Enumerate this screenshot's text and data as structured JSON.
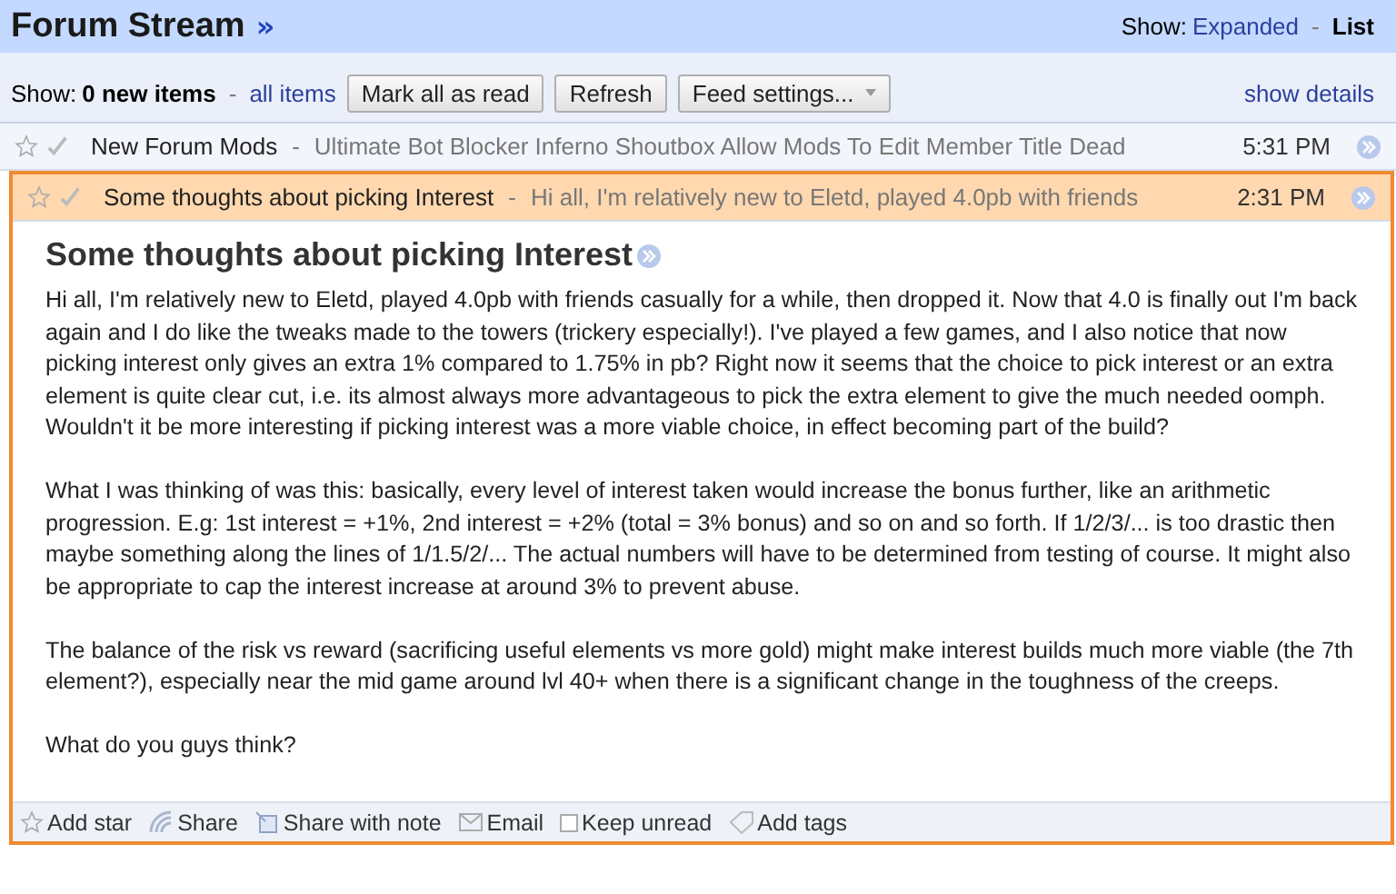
{
  "header": {
    "title": "Forum Stream",
    "title_link": "»",
    "show_label": "Show:",
    "separator": "-",
    "view_modes": [
      {
        "label": "Expanded",
        "selected": false
      },
      {
        "label": "List",
        "selected": true
      }
    ]
  },
  "toolbar": {
    "show_label": "Show:",
    "separator": "-",
    "filters": [
      {
        "label": "0 new items",
        "selected": true
      },
      {
        "label": "all items",
        "selected": false
      }
    ],
    "buttons": [
      {
        "label": "Mark all as read",
        "kind": "button"
      },
      {
        "label": "Refresh",
        "kind": "button"
      },
      {
        "label": "Feed settings...",
        "kind": "dropdown"
      }
    ],
    "details_link": "show details"
  },
  "items": [
    {
      "title": "New Forum Mods",
      "separator": "-",
      "snippet": "Ultimate Bot Blocker Inferno Shoutbox Allow Mods To Edit Member Title Dead",
      "time": "5:31 PM",
      "starred": false,
      "expanded": false
    },
    {
      "title": "Some thoughts about picking Interest",
      "separator": "-",
      "snippet": "Hi all, I'm relatively new to Eletd, played 4.0pb with friends",
      "time": "2:31 PM",
      "starred": false,
      "expanded": true,
      "body": {
        "title": "Some thoughts about picking Interest",
        "paragraphs": [
          "Hi all, I'm relatively new to Eletd, played 4.0pb with friends casually for a while, then dropped it. Now that 4.0 is finally out I'm back again and I do like the tweaks made to the towers (trickery especially!). I've played a few games, and I also notice that now picking interest only gives an extra 1% compared to 1.75% in pb? Right now it seems that the choice to pick interest or an extra element is quite clear cut, i.e. its almost always more advantageous to pick the extra element to give the much needed oomph. Wouldn't it be more interesting if picking interest was a more viable choice, in effect becoming part of the build?",
          "What I was thinking of was this: basically, every level of interest taken would increase the bonus further, like an arithmetic progression. E.g: 1st interest = +1%, 2nd interest = +2% (total = 3% bonus) and so on and so forth. If 1/2/3/... is too drastic then maybe something along the lines of 1/1.5/2/... The actual numbers will have to be determined from testing of course. It might also be appropriate to cap the interest increase at around 3% to prevent abuse.",
          "The balance of the risk vs reward (sacrificing useful elements vs more gold) might make interest builds much more viable (the 7th element?), especially near the mid game around lvl 40+ when there is a significant change in the toughness of the creeps.",
          "What do you guys think?"
        ]
      },
      "actions": [
        {
          "label": "Add star",
          "kind": "star"
        },
        {
          "label": "Share",
          "kind": "share"
        },
        {
          "label": "Share with note",
          "kind": "note"
        },
        {
          "label": "Email",
          "kind": "email"
        },
        {
          "label": "Keep unread",
          "kind": "checkbox",
          "checked": false
        },
        {
          "label": "Add tags",
          "kind": "tag"
        }
      ]
    }
  ]
}
